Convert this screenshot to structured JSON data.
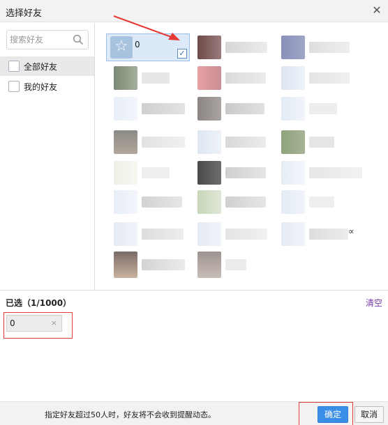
{
  "window": {
    "title": "选择好友"
  },
  "search": {
    "placeholder": "搜索好友"
  },
  "groups": [
    {
      "label": "全部好友"
    },
    {
      "label": "我的好友"
    }
  ],
  "friends": {
    "selected_nickname": "0",
    "extra_label": "∝"
  },
  "selected_panel": {
    "count_label": "已选（1/1000）",
    "clear_label": "清空",
    "chips": [
      "0"
    ],
    "chip_remove_symbol": "×"
  },
  "footer": {
    "hint": "指定好友超过50人时，好友将不会收到提醒动态。",
    "ok_label": "确定",
    "cancel_label": "取消"
  },
  "colors": {
    "accent": "#3a8ee6",
    "selected_tile": "#dbe9f8",
    "highlight_outline": "#e03c3c",
    "clear_link": "#7a3aa8"
  }
}
